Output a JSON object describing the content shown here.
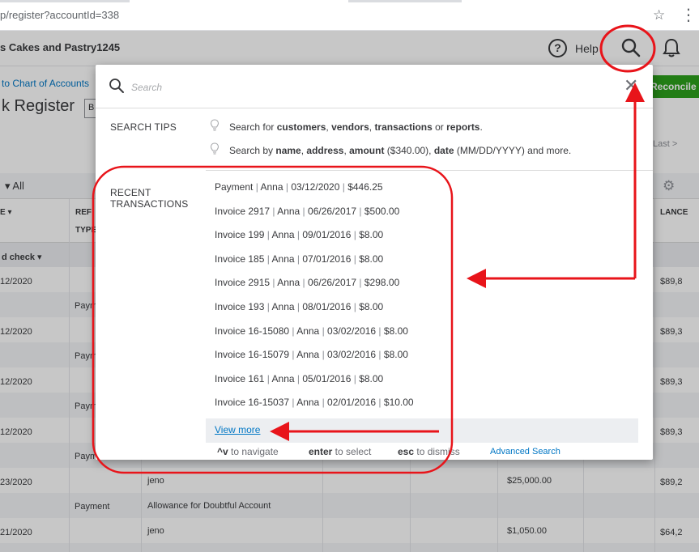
{
  "browser": {
    "url": "p/register?accountId=338",
    "star_icon": "star-icon",
    "menu_icon": "kebab-menu-icon"
  },
  "header": {
    "company": "s Cakes and Pastry1245",
    "help_label": "Help",
    "icons": [
      "help-circle-icon",
      "search-icon",
      "bell-icon"
    ]
  },
  "page": {
    "breadcrumb": "to Chart of Accounts",
    "title": "k Register",
    "register_box": "B",
    "reconcile_label": "Reconcile",
    "last_link": "Last >",
    "filter_label": "All",
    "columns": {
      "date": "E",
      "ref": "REF",
      "type": "TYPE",
      "balance": "LANCE"
    },
    "group_label": "d check",
    "rows": [
      {
        "date": "12/2020",
        "type": "Paym",
        "payee": "",
        "account": "",
        "amount": "",
        "balance": "$89,8"
      },
      {
        "date": "12/2020",
        "type": "Paym",
        "payee": "",
        "account": "",
        "amount": "",
        "balance": "$89,3"
      },
      {
        "date": "12/2020",
        "type": "Paym",
        "payee": "",
        "account": "",
        "amount": "",
        "balance": "$89,3"
      },
      {
        "date": "12/2020",
        "type": "Paym",
        "payee": "",
        "account": "",
        "amount": "",
        "balance": "$89,3"
      },
      {
        "date": "23/2020",
        "type": "Payment",
        "payee": "jeno",
        "account": "Allowance for Doubtful Account",
        "amount": "$25,000.00",
        "balance": "$89,2"
      },
      {
        "date": "21/2020",
        "type": "",
        "payee": "jeno",
        "account": "",
        "amount": "$1,050.00",
        "balance": "$64,2"
      }
    ]
  },
  "search_modal": {
    "placeholder": "Search",
    "close_icon": "close-x-icon",
    "tips_heading": "SEARCH TIPS",
    "tips": [
      {
        "prefix": "Search for ",
        "b1": "customers",
        "s1": ", ",
        "b2": "vendors",
        "s2": ", ",
        "b3": "transactions",
        "s3": " or ",
        "b4": "reports",
        "suffix": "."
      },
      {
        "prefix": "Search by ",
        "b1": "name",
        "s1": ", ",
        "b2": "address",
        "s2": ", ",
        "b3": "amount",
        "s3": " ($340.00), ",
        "b4": "date",
        "suffix": " (MM/DD/YYYY) and more."
      }
    ],
    "recent_heading_line1": "RECENT",
    "recent_heading_line2": "TRANSACTIONS",
    "recent": [
      {
        "name": "Payment ",
        "customer": "Anna",
        "date": "03/12/2020",
        "amount": "$446.25"
      },
      {
        "name": "Invoice 2917",
        "customer": "Anna",
        "date": "06/26/2017",
        "amount": "$500.00"
      },
      {
        "name": "Invoice 199",
        "customer": "Anna",
        "date": "09/01/2016",
        "amount": "$8.00"
      },
      {
        "name": "Invoice 185",
        "customer": "Anna",
        "date": "07/01/2016",
        "amount": "$8.00"
      },
      {
        "name": "Invoice 2915",
        "customer": "Anna",
        "date": "06/26/2017",
        "amount": "$298.00"
      },
      {
        "name": "Invoice 193",
        "customer": "Anna",
        "date": "08/01/2016",
        "amount": "$8.00"
      },
      {
        "name": "Invoice 16-15080",
        "customer": "Anna",
        "date": "03/02/2016",
        "amount": "$8.00"
      },
      {
        "name": "Invoice 16-15079",
        "customer": "Anna",
        "date": "03/02/2016",
        "amount": "$8.00"
      },
      {
        "name": "Invoice 161",
        "customer": "Anna",
        "date": "05/01/2016",
        "amount": "$8.00"
      },
      {
        "name": "Invoice 16-15037",
        "customer": "Anna",
        "date": "02/01/2016",
        "amount": "$10.00"
      }
    ],
    "view_more": "View more",
    "footer": {
      "nav_key": "^v",
      "nav_text": " to navigate",
      "select_key": "enter",
      "select_text": " to select",
      "dismiss_key": "esc",
      "dismiss_text": " to dismiss",
      "advanced_search": "Advanced Search"
    }
  },
  "annotation_color": "#e8141a"
}
